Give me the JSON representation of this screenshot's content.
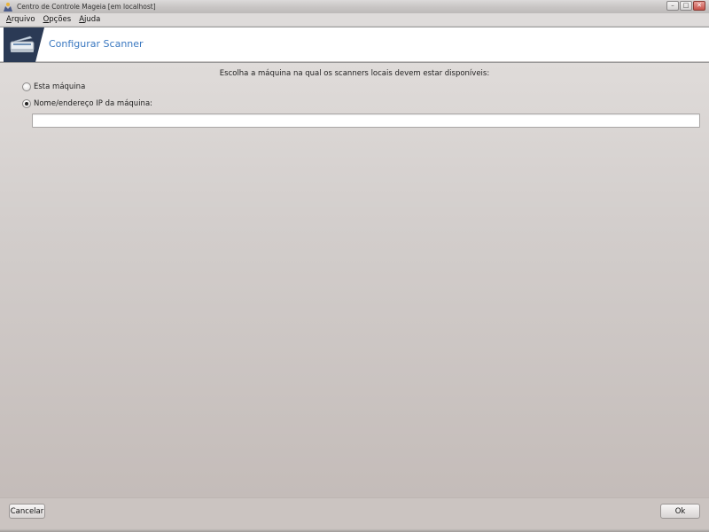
{
  "window": {
    "title": "Centro de Controle Mageia  [em localhost]",
    "minimize_glyph": "–",
    "maximize_glyph": "□",
    "close_glyph": "✕"
  },
  "menubar": {
    "items": [
      {
        "label_first": "A",
        "label_rest": "rquivo"
      },
      {
        "label_first": "O",
        "label_rest": "pções"
      },
      {
        "label_first": "A",
        "label_rest": "juda"
      }
    ]
  },
  "header": {
    "icon": "scanner-icon",
    "title": "Configurar Scanner"
  },
  "main": {
    "instruction": "Escolha a máquina na qual os scanners locais devem estar disponíveis:",
    "options": [
      {
        "label": "Esta máquina",
        "selected": false
      },
      {
        "label": "Nome/endereço IP da máquina:",
        "selected": true
      }
    ],
    "host_input": {
      "value": "",
      "placeholder": ""
    }
  },
  "footer": {
    "cancel_label": "Cancelar",
    "ok_label": "Ok"
  },
  "colors": {
    "accent": "#3a78c0",
    "header_icon_bg": "#2b3a55"
  }
}
